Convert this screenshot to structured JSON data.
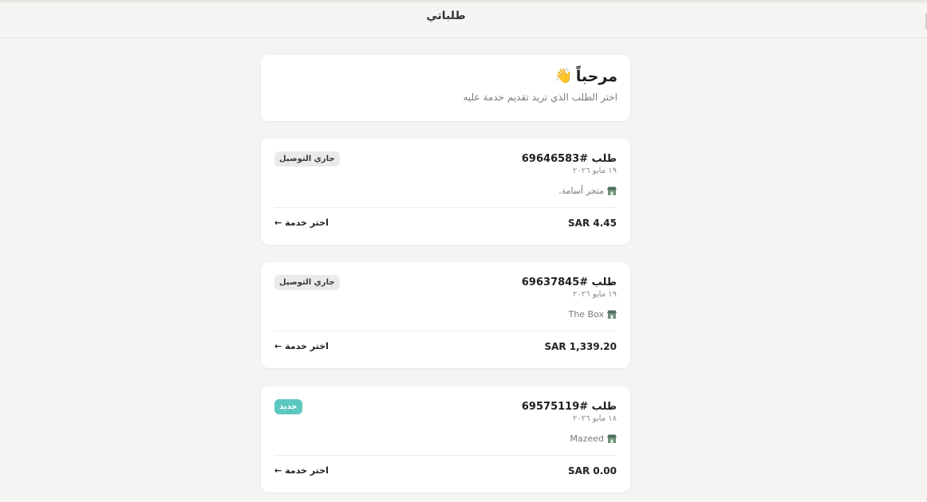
{
  "header": {
    "title": "طلباتي"
  },
  "welcome": {
    "title": "مرحباً",
    "emoji": "👋",
    "subtitle": "اختر الطلب الذي تريد تقديم خدمة عليه"
  },
  "orders": [
    {
      "title": "طلب #69646583",
      "date": "١٩ مايو ٢٠٢٦",
      "store": "متجر أسامة.",
      "total": "SAR 4.45",
      "status": "جاري التوصيل",
      "status_color": "#ebeae8",
      "action": "اختر خدمة",
      "arrow": "←"
    },
    {
      "title": "طلب #69637845",
      "date": "١٩ مايو ٢٠٢٦",
      "store": "The Box",
      "total": "SAR 1,339.20",
      "status": "جاري التوصيل",
      "status_color": "#ebeae8",
      "action": "اختر خدمة",
      "arrow": "←"
    },
    {
      "title": "طلب #69575119",
      "date": "١٨ مايو ٢٠٢٦",
      "store": "Mazeed",
      "total": "SAR 0.00",
      "status": "جديد",
      "status_color": "#5cc7c0",
      "action": "اختر خدمة",
      "arrow": "←"
    }
  ],
  "icons": {
    "store": "store-icon",
    "wave": "waving-hand-icon"
  }
}
